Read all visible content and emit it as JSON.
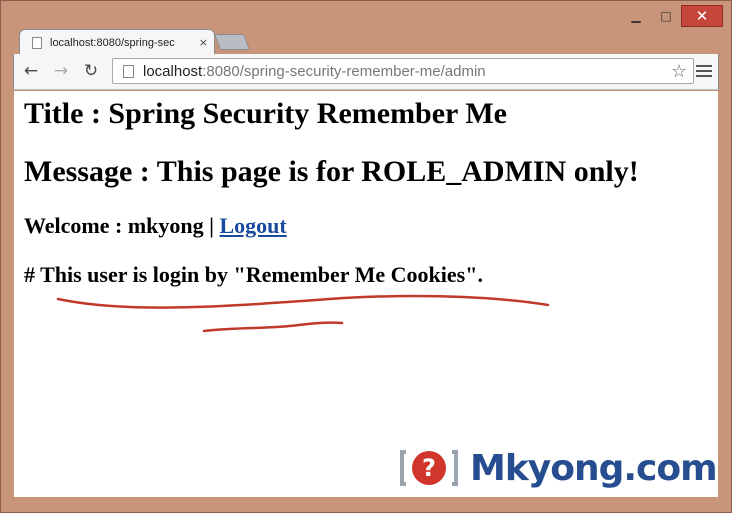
{
  "window": {
    "controls": {
      "minimize_icon": "minimize-icon",
      "maximize_icon": "maximize-icon",
      "close_icon": "close-icon"
    }
  },
  "tab": {
    "title": "localhost:8080/spring-sec",
    "close_glyph": "×"
  },
  "toolbar": {
    "back_glyph": "←",
    "forward_glyph": "→",
    "reload_glyph": "↻",
    "url_host": "localhost",
    "url_rest": ":8080/spring-security-remember-me/admin",
    "star_glyph": "☆"
  },
  "page": {
    "title_line": "Title : Spring Security Remember Me",
    "message_line": "Message : This page is for ROLE_ADMIN only!",
    "welcome_prefix": "Welcome : mkyong | ",
    "logout_link": "Logout",
    "note_line": "# This user is login by \"Remember Me Cookies\"."
  },
  "watermark": {
    "text": "Mkyong.com",
    "mark_glyph": "?"
  },
  "colors": {
    "frame": "#c9957a",
    "close_button": "#c7463b",
    "link": "#1a4a9e",
    "scribble": "#c0392b",
    "logo": "#254d8f"
  }
}
